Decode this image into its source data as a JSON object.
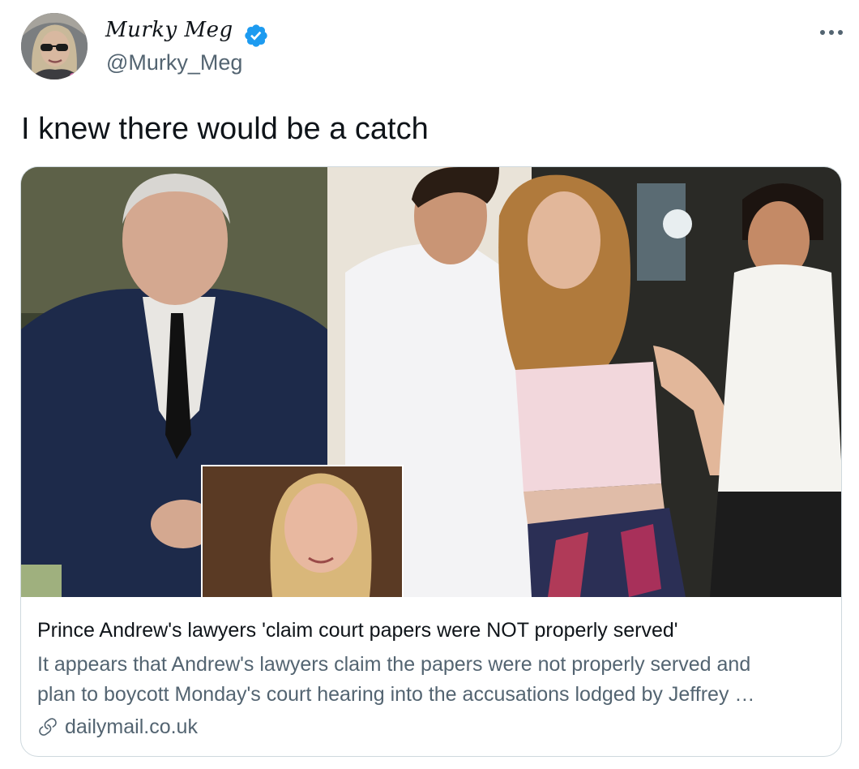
{
  "author": {
    "display_name": "Murky Meg",
    "handle": "@Murky_Meg",
    "verified": true,
    "avatar_icon": "user-avatar"
  },
  "tweet": {
    "text": "I knew there would be a catch"
  },
  "link_card": {
    "title": "Prince Andrew's lawyers 'claim court papers were NOT properly served'",
    "description_line_1": "It appears that Andrew's lawyers claim the papers were not properly served and",
    "description_line_2": "plan to boycott Monday's court hearing into the accusations lodged by Jeffrey …",
    "domain": "dailymail.co.uk",
    "link_icon": "link-icon"
  },
  "colors": {
    "verified_blue": "#1d9bf0",
    "text_primary": "#0f1419",
    "text_secondary": "#536471",
    "border": "#cfd9de"
  }
}
